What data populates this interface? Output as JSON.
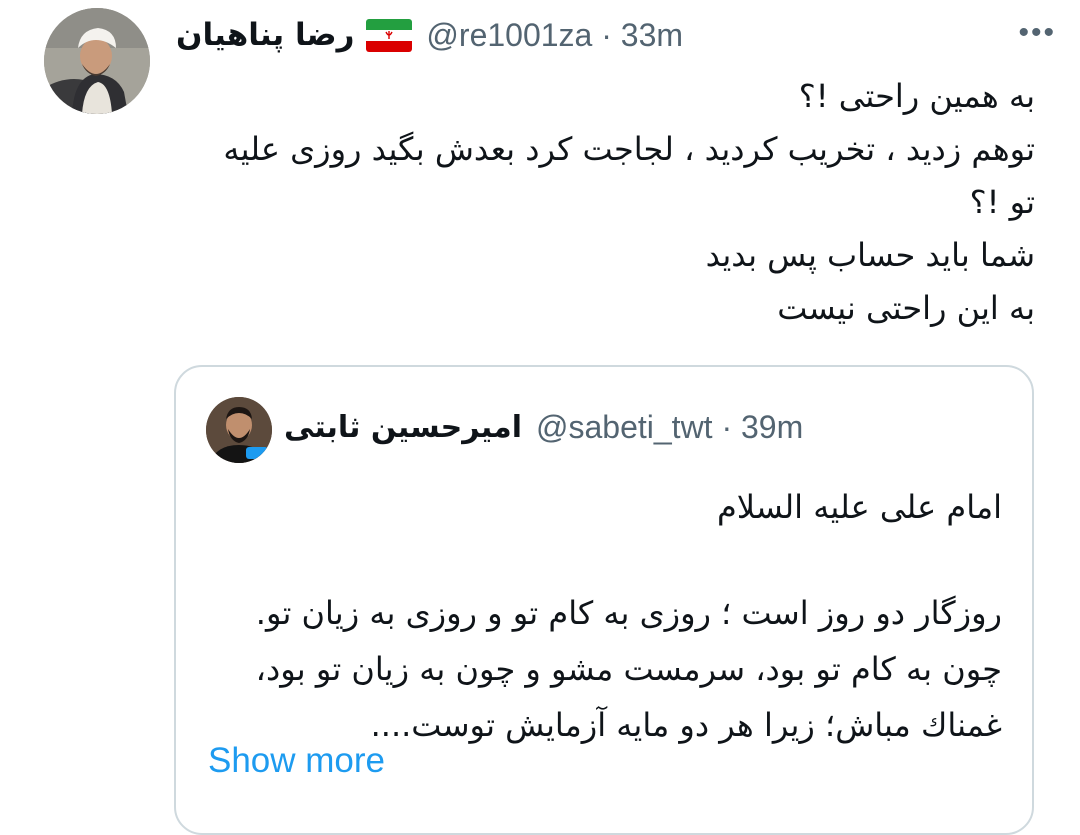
{
  "tweet": {
    "author_name": "رضا پناهیان",
    "handle": "@re1001za",
    "time": "33m",
    "separator": "·",
    "more_icon": "more-horizontal-icon",
    "text_lines": [
      "به همین راحتی !؟",
      "توهم زدید ، تخریب کردید ، لجاجت کرد بعدش بگید روزی علیه",
      "تو !؟",
      "شما باید حساب پس بدید",
      "به این راحتی نیست"
    ]
  },
  "quote": {
    "author_name": "امیرحسین ثابتی",
    "handle": "@sabeti_twt",
    "time": "39m",
    "separator": "·",
    "text_lines": [
      "امام علی علیه السلام",
      "",
      "روزگار دو روز است ؛ روزی به کام تو و روزی به زیان تو.",
      "چون به کام تو بود، سرمست مشو و چون به زیان تو بود،",
      "غمناك مباش؛ زیرا هر دو مایه آزمایش توست...."
    ],
    "show_more": "Show more"
  },
  "colors": {
    "text": "#0f1419",
    "secondary": "#536471",
    "link": "#1d9bf0",
    "border": "#cfd9de"
  }
}
